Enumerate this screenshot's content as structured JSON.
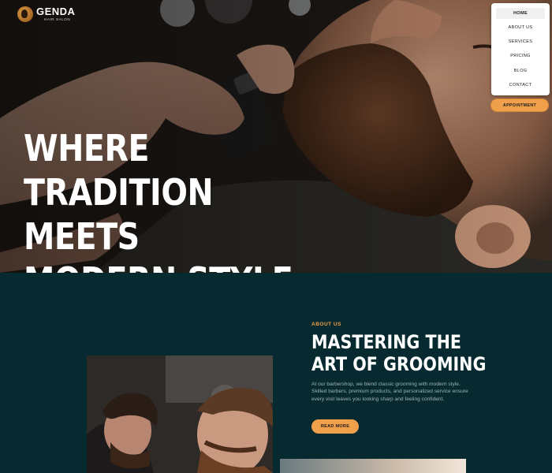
{
  "brand": {
    "name": "GENDA",
    "tagline": "HAIR SALON"
  },
  "nav": {
    "items": [
      {
        "label": "HOME",
        "active": true
      },
      {
        "label": "ABOUT US",
        "active": false
      },
      {
        "label": "SERVICES",
        "active": false
      },
      {
        "label": "PRICING",
        "active": false
      },
      {
        "label": "BLOG",
        "active": false
      },
      {
        "label": "CONTACT",
        "active": false
      }
    ],
    "cta_label": "APPOINTMENT"
  },
  "hero": {
    "title_lines": [
      "WHERE",
      "TRADITION MEETS",
      "MODERN STYLE"
    ]
  },
  "about": {
    "eyebrow": "ABOUT US",
    "title_lines": [
      "MASTERING THE",
      "ART OF GROOMING"
    ],
    "body": "At our barbershop, we blend classic grooming with modern style. Skilled barbers, premium products, and personalized service ensure every visit leaves you looking sharp and feeling confident.",
    "button_label": "READ MORE"
  },
  "colors": {
    "accent": "#f0a04b",
    "section_bg": "#062a30",
    "nav_bg": "#ffffff"
  },
  "icons": {
    "logo": "barber-head-logo-icon"
  }
}
